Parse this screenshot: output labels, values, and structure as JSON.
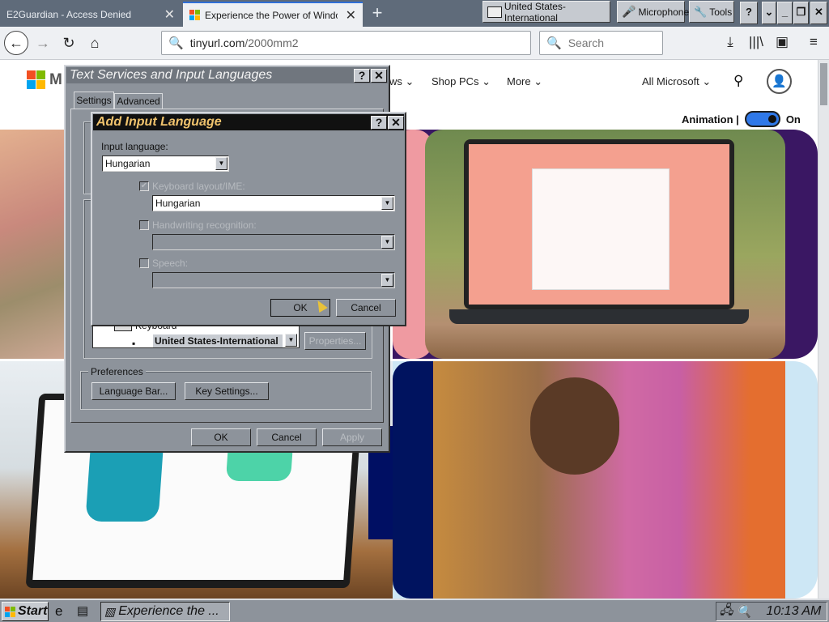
{
  "browser": {
    "tabs": [
      {
        "title": "E2Guardian - Access Denied"
      },
      {
        "title": "Experience the Power of Windows"
      }
    ],
    "lang_indicator": "United States-International",
    "microphone_label": "Microphone",
    "tools_label": "Tools",
    "url": {
      "host": "tinyurl.com",
      "path": "/2000mm2"
    },
    "search_placeholder": "Search"
  },
  "page": {
    "brand_letter": "M",
    "nav": {
      "windows_partial": "ws",
      "shop_pcs": "Shop PCs",
      "more": "More",
      "all_microsoft": "All Microsoft"
    },
    "animation_label": "Animation |",
    "animation_state": "On"
  },
  "text_services": {
    "title": "Text Services and Input Languages",
    "tabs": [
      "Settings",
      "Advanced"
    ],
    "keyboard_label": "Keyboard",
    "installed_item": "United States-International",
    "properties_button": "Properties...",
    "preferences_label": "Preferences",
    "language_bar_button": "Language Bar...",
    "key_settings_button": "Key Settings...",
    "ok": "OK",
    "cancel": "Cancel",
    "apply": "Apply"
  },
  "add_input_language": {
    "title": "Add Input Language",
    "input_language_label": "Input language:",
    "input_language_value": "Hungarian",
    "keyboard_layout_label": "Keyboard layout/IME:",
    "keyboard_layout_value": "Hungarian",
    "handwriting_label": "Handwriting recognition:",
    "speech_label": "Speech:",
    "ok": "OK",
    "cancel": "Cancel"
  },
  "taskbar": {
    "start_label": "Start",
    "task_item": "Experience the ...",
    "clock": "10:13 AM"
  },
  "colors": {
    "accent_blue": "#2f78e8",
    "dialog_gray": "#8d939b",
    "titlebar_dark": "#6f757d",
    "active_titlebar": "#111111"
  }
}
